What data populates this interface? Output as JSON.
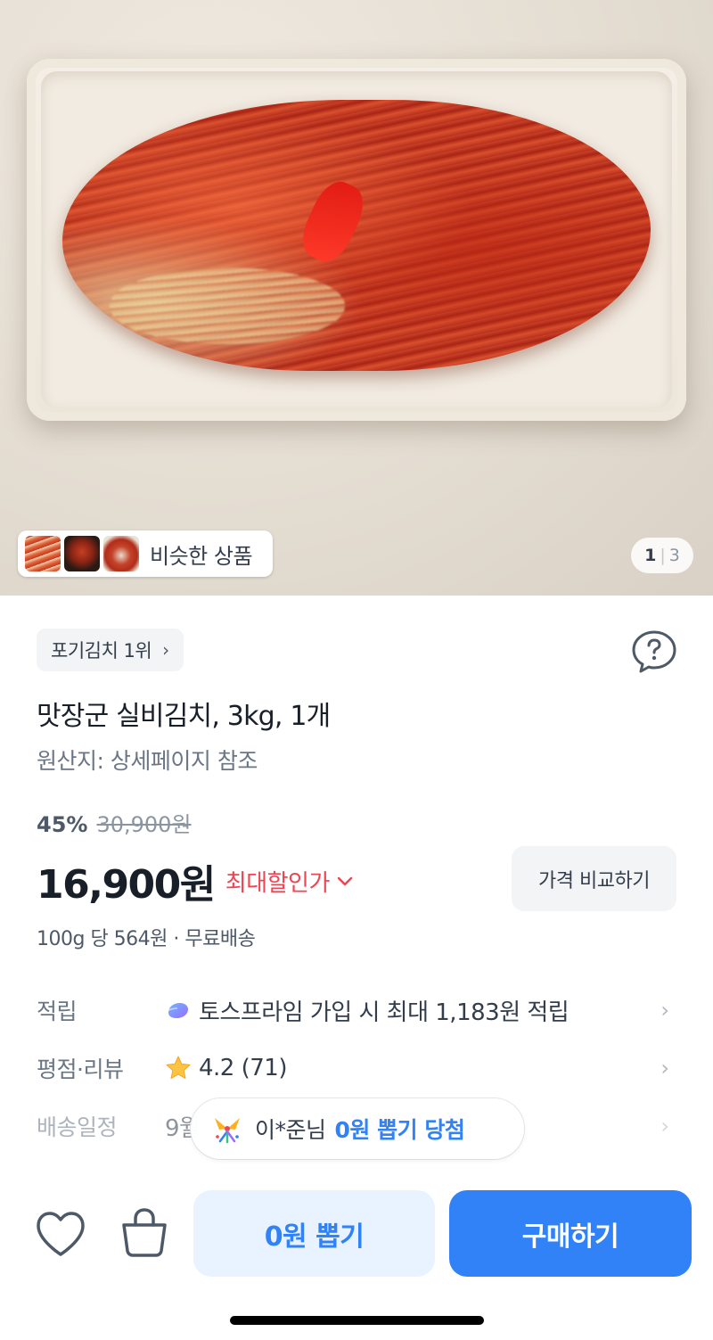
{
  "hero": {
    "image_alt": "kimchi-on-plate-photo",
    "similar_label": "비슷한 상품",
    "counter_current": "1",
    "counter_separator": "|",
    "counter_total": "3"
  },
  "product": {
    "rank_label": "포기김치 1위",
    "rank_chevron": "›",
    "title": "맛장군 실비김치, 3kg, 1개",
    "origin": "원산지: 상세페이지 참조",
    "discount_pct": "45%",
    "original_price": "30,900원",
    "price": "16,900원",
    "price_tag": "최대할인가",
    "price_tag_chevron": "⌄",
    "compare_button": "가격 비교하기",
    "unit_info": "100g 당 564원 · 무료배송"
  },
  "info_rows": {
    "earn": {
      "label": "적립",
      "value": "토스프라임 가입 시 최대 1,183원 적립",
      "icon": "prime-icon"
    },
    "review": {
      "label": "평점·리뷰",
      "value": "4.2 (71)",
      "icon": "star-icon"
    },
    "shipping": {
      "label": "배송일정",
      "value": "9월"
    },
    "chevron": "›"
  },
  "toast": {
    "name": "이*준님",
    "win_text": "0원 뽑기 당첨",
    "icon": "confetti-icon"
  },
  "bottom_bar": {
    "draw_button": "0원 뽑기",
    "buy_button": "구매하기"
  },
  "colors": {
    "accent_blue": "#3182f6",
    "accent_red": "#f04452",
    "light_blue_bg": "#e8f3ff",
    "chip_bg": "#f2f4f6",
    "star_yellow": "#ffc342"
  }
}
